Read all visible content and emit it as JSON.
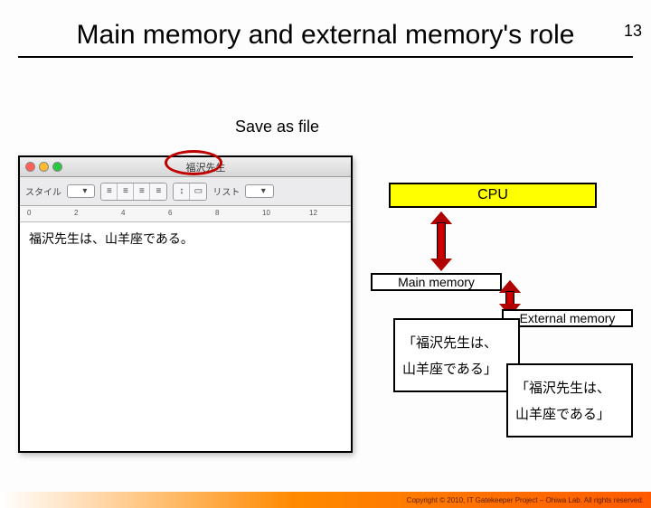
{
  "page_number": "13",
  "title": "Main memory and external memory's role",
  "save_as_file": "Save as file",
  "screenshot": {
    "window_title": "福沢先生",
    "toolbar_style_label": "スタイル",
    "toolbar_list_label": "リスト",
    "ruler": [
      "0",
      "2",
      "4",
      "6",
      "8",
      "10",
      "12"
    ],
    "body_text": "福沢先生は、山羊座である。"
  },
  "diagram": {
    "cpu": "CPU",
    "main_memory": "Main memory",
    "external_memory": "External memory",
    "text_line1": "「福沢先生は、",
    "text_line2": "山羊座である」"
  },
  "footer": "Copyright © 2010, IT Gatekeeper Project – Ohiwa Lab. All rights reserved."
}
